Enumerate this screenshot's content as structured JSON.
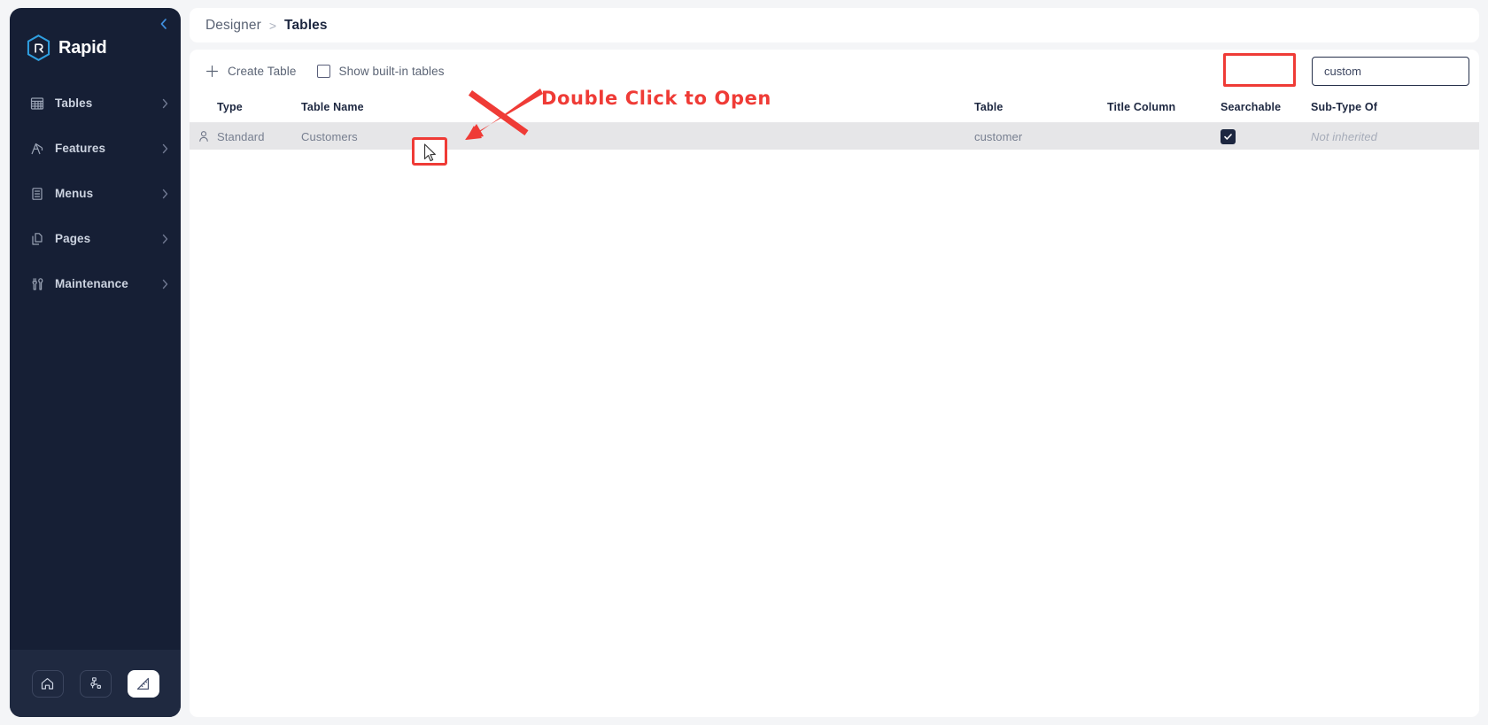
{
  "brand": {
    "name": "Rapid",
    "logo_icon": "rapid-hexagon-logo"
  },
  "sidebar": {
    "collapse_icon": "chevron-left-icon",
    "items": [
      {
        "label": "Tables",
        "icon": "table-grid-icon",
        "chevron": "chevron-right-icon"
      },
      {
        "label": "Features",
        "icon": "crane-icon",
        "chevron": "chevron-right-icon"
      },
      {
        "label": "Menus",
        "icon": "list-document-icon",
        "chevron": "chevron-right-icon"
      },
      {
        "label": "Pages",
        "icon": "pages-copy-icon",
        "chevron": "chevron-right-icon"
      },
      {
        "label": "Maintenance",
        "icon": "tools-icon",
        "chevron": "chevron-right-icon"
      }
    ],
    "dock": [
      {
        "name": "home-icon",
        "active": false
      },
      {
        "name": "sitemap-icon",
        "active": false
      },
      {
        "name": "designer-ruler-icon",
        "active": true
      }
    ]
  },
  "breadcrumb": {
    "parent": "Designer",
    "separator": ">",
    "current": "Tables"
  },
  "toolbar": {
    "create_label": "Create Table",
    "create_icon": "plus-icon",
    "show_builtin_label": "Show built-in tables",
    "show_builtin_checked": false
  },
  "search": {
    "value": "custom",
    "placeholder": "",
    "clear_icon": "close-x-icon"
  },
  "table": {
    "columns": [
      {
        "key": "icon",
        "label": ""
      },
      {
        "key": "type",
        "label": "Type"
      },
      {
        "key": "name",
        "label": "Table Name"
      },
      {
        "key": "table",
        "label": "Table"
      },
      {
        "key": "title",
        "label": "Title Column"
      },
      {
        "key": "search",
        "label": "Searchable"
      },
      {
        "key": "sub",
        "label": "Sub-Type Of"
      }
    ],
    "rows": [
      {
        "icon": "user-person-icon",
        "type": "Standard",
        "name": "Customers",
        "table": "customer",
        "title": "",
        "searchable": true,
        "sub": "Not inherited"
      }
    ]
  },
  "annotations": {
    "callout_text": "Double Click to Open",
    "callout_color": "#ef3b36",
    "arrow_icon": "red-arrow-down-left",
    "cursor_icon": "mouse-pointer-icon"
  }
}
